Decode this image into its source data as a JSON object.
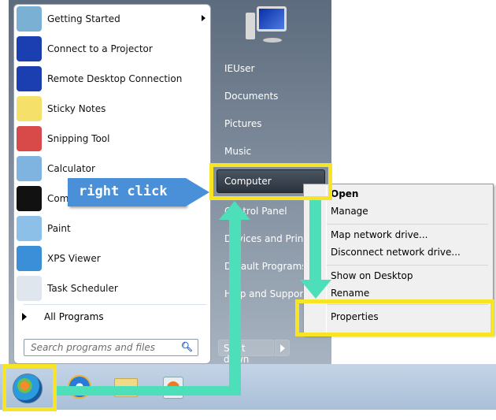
{
  "programs": [
    {
      "label": "Getting Started",
      "icon": "getting-started-icon",
      "color": "#7ab0d4",
      "submenu": true
    },
    {
      "label": "Connect to a Projector",
      "icon": "projector-icon",
      "color": "#1b3fb0"
    },
    {
      "label": "Remote Desktop Connection",
      "icon": "remote-desktop-icon",
      "color": "#1b3fb0"
    },
    {
      "label": "Sticky Notes",
      "icon": "sticky-notes-icon",
      "color": "#f5e06a"
    },
    {
      "label": "Snipping Tool",
      "icon": "snipping-tool-icon",
      "color": "#d84a4a"
    },
    {
      "label": "Calculator",
      "icon": "calculator-icon",
      "color": "#7fb3e0"
    },
    {
      "label": "Command Prompt",
      "icon": "command-prompt-icon",
      "color": "#111111"
    },
    {
      "label": "Paint",
      "icon": "paint-icon",
      "color": "#8cc0e8"
    },
    {
      "label": "XPS Viewer",
      "icon": "xps-viewer-icon",
      "color": "#3a8fd8"
    },
    {
      "label": "Task Scheduler",
      "icon": "task-scheduler-icon",
      "color": "#dfe6ee"
    }
  ],
  "all_programs": "All Programs",
  "search_placeholder": "Search programs and files",
  "right_items": [
    "IEUser",
    "Documents",
    "Pictures",
    "Music",
    "Computer",
    "Control Panel",
    "Devices and Printers",
    "Default Programs",
    "Help and Support"
  ],
  "shutdown": "Shut down",
  "context_menu": [
    "Open",
    "Manage",
    "Map network drive...",
    "Disconnect network drive...",
    "Show on Desktop",
    "Rename",
    "Properties"
  ],
  "callout": "right click",
  "colors": {
    "highlight": "#f6e425",
    "arrow": "#4ddfb9",
    "callout": "#4a90d9"
  }
}
